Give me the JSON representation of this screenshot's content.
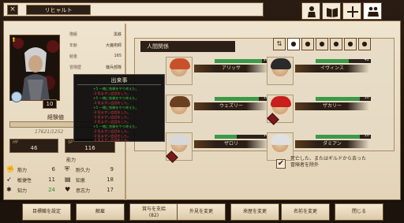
{
  "window": {
    "title": "リヒャルト",
    "close_icon": "x-icon"
  },
  "top_tabs": [
    {
      "icon": "person-icon"
    },
    {
      "icon": "book-icon"
    },
    {
      "icon": "plus-icon"
    },
    {
      "icon": "group-icon"
    }
  ],
  "character": {
    "level": "10",
    "stats": [
      {
        "label": "階級",
        "value": "黒鉄"
      },
      {
        "label": "年齢",
        "value": "大魔術師"
      },
      {
        "label": "給金",
        "value": "165"
      },
      {
        "label": "冒険歴",
        "value": "傭兵部隊"
      }
    ],
    "exp_label": "経験値",
    "exp_value": "17621/1252",
    "hp_label": "HP",
    "hp_value": "46",
    "sp_label": "SP",
    "sp_value": "116",
    "ability_header": "能力",
    "abilities": [
      {
        "icon": "fist-icon",
        "label": "筋力",
        "value": "6"
      },
      {
        "icon": "shield-icon",
        "label": "耐久力",
        "value": "9"
      },
      {
        "icon": "feather-icon",
        "label": "敏捷性",
        "value": "11"
      },
      {
        "icon": "book-icon",
        "label": "知恵",
        "value": "18"
      },
      {
        "icon": "brain-icon",
        "label": "知力",
        "value": "24"
      },
      {
        "icon": "heart-icon",
        "label": "意志力",
        "value": "17"
      }
    ]
  },
  "events_popup": {
    "title": "出来事",
    "lines": [
      {
        "text": "+5 一緒に依頼をやり終えた。",
        "color": "#3fc53f"
      },
      {
        "text": "-3 気まずい会話をした。",
        "color": "#e04040"
      },
      {
        "text": "+5 一緒に依頼をやり終えた。",
        "color": "#3fc53f"
      },
      {
        "text": "-3 気まずい会話をした。",
        "color": "#e04040"
      },
      {
        "text": "+5 一緒に依頼をやり終えた。",
        "color": "#3fc53f"
      },
      {
        "text": "-3 気まずい会話をした。",
        "color": "#e04040"
      },
      {
        "text": "-3 気まずい会話をした。",
        "color": "#e04040"
      },
      {
        "text": "-3 気まずい会話をした。",
        "color": "#e04040"
      },
      {
        "text": "+5 一緒に依頼をやり終えた。",
        "color": "#3fc53f"
      },
      {
        "text": "-3 気まずい会話をした。",
        "color": "#e04040"
      },
      {
        "text": "-3 気まずい会話をした。",
        "color": "#e04040"
      },
      {
        "text": "-3 気まずい会話をした。",
        "color": "#e04040"
      }
    ]
  },
  "relations": {
    "title": "人間関係",
    "filter_icons": [
      "sort-icon",
      "coin-icon",
      "coin-icon",
      "coin-icon",
      "coin-icon",
      "coin-icon",
      "coin-icon"
    ],
    "people": [
      {
        "name": "アリッサ",
        "level": "10",
        "hair": "#c8502a",
        "bar": 0.85
      },
      {
        "name": "イヴィンス",
        "level": "42",
        "hair": "#2a2a2a",
        "bar": 0.6
      },
      {
        "name": "ウェズリー",
        "level": "10",
        "hair": "#6a4020",
        "bar": 0.8
      },
      {
        "name": "ザカリー",
        "level": "10",
        "hair": "#c81e1e",
        "bar": 0.8
      },
      {
        "name": "ザロリ",
        "level": "14",
        "hair": "#d8d8d8",
        "bar": 0.4
      },
      {
        "name": "ダミアン",
        "level": "10",
        "hair": "#e0e0e0",
        "bar": 0.8
      }
    ]
  },
  "option": {
    "checked": "✔",
    "text_line1": "死亡した、またはギルドから去った",
    "text_line2": "冒険者を除外"
  },
  "bottom_buttons": [
    {
      "label": "目標職を設定"
    },
    {
      "label": "解雇"
    },
    {
      "label": "賞与を支給",
      "sub": "(82)"
    },
    {
      "label": "外見を変更"
    },
    {
      "label": "来歴を変更"
    },
    {
      "label": "名前を変更"
    },
    {
      "label": "閉じる"
    }
  ]
}
